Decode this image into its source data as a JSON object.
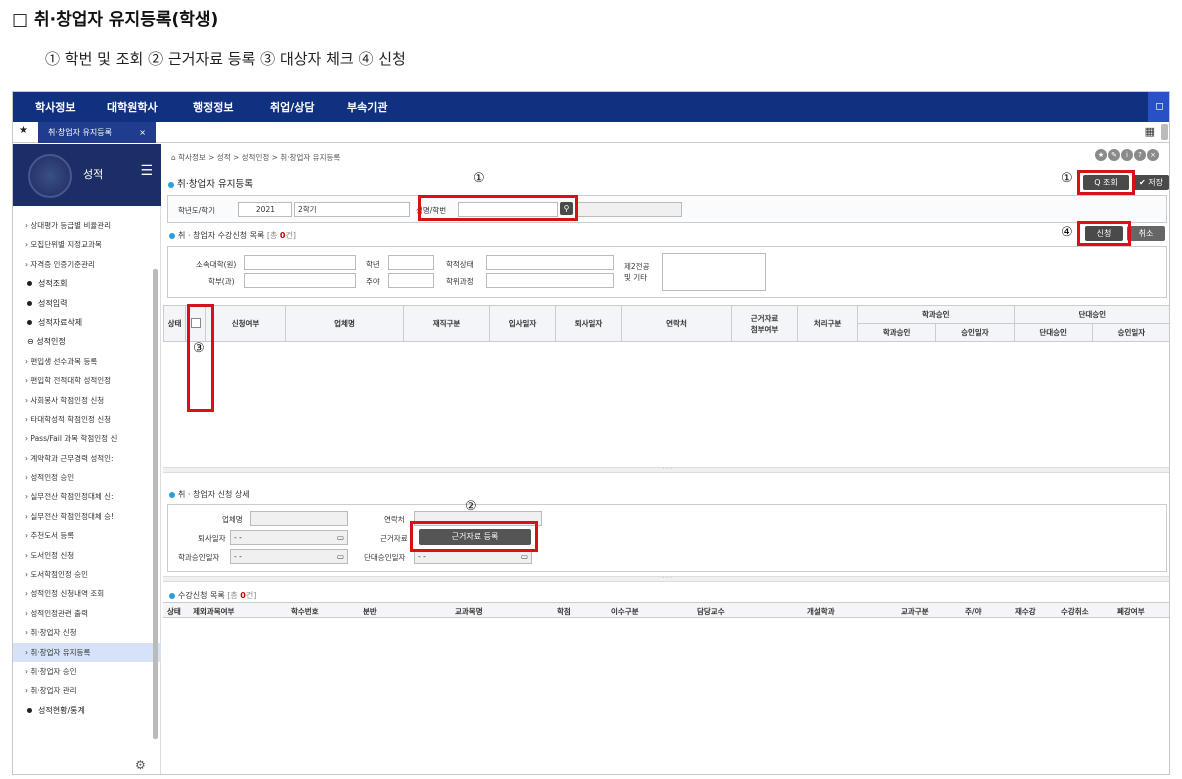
{
  "doc": {
    "title": "□ 취·창업자 유지등록(학생)",
    "steps": "① 학번 및 조회 ② 근거자료 등록 ③ 대상자 체크 ④ 신청"
  },
  "topnav": {
    "items": [
      "학사정보",
      "대학원학사",
      "행정정보",
      "취업/상담",
      "부속기관"
    ],
    "bookmark": "◻"
  },
  "tab": {
    "label": "취·창업자 유지등록",
    "close": "×"
  },
  "sidebar": {
    "title": "성적",
    "items": [
      {
        "label": "상대평가 등급별 비율관리",
        "kind": "sub"
      },
      {
        "label": "모집단위별 지정교과목",
        "kind": "sub"
      },
      {
        "label": "자격증 인증기준관리",
        "kind": "sub"
      },
      {
        "label": "성적조회",
        "kind": "top"
      },
      {
        "label": "성적입력",
        "kind": "top"
      },
      {
        "label": "성적자료삭제",
        "kind": "top"
      },
      {
        "label": "성적인정",
        "kind": "open"
      },
      {
        "label": "편입생 선수과목 등록",
        "kind": "sub"
      },
      {
        "label": "편입학 전적대학 성적인정",
        "kind": "sub"
      },
      {
        "label": "사회봉사 학점인정 신청",
        "kind": "sub"
      },
      {
        "label": "타대학성적 학점인정 신청",
        "kind": "sub"
      },
      {
        "label": "Pass/Fail 과목 학점인정 신",
        "kind": "sub"
      },
      {
        "label": "계약학과 근무경력 성적인:",
        "kind": "sub"
      },
      {
        "label": "성적인정 승인",
        "kind": "sub"
      },
      {
        "label": "실무전산 학점인정대체 신:",
        "kind": "sub"
      },
      {
        "label": "실무전산 학점인정대체 승!",
        "kind": "sub"
      },
      {
        "label": "추천도서 등록",
        "kind": "sub"
      },
      {
        "label": "도서인정 신청",
        "kind": "sub"
      },
      {
        "label": "도서학점인정 승인",
        "kind": "sub"
      },
      {
        "label": "성적인정 신청내역 조회",
        "kind": "sub"
      },
      {
        "label": "성적인정관련 출력",
        "kind": "sub"
      },
      {
        "label": "취·창업자 신청",
        "kind": "sub"
      },
      {
        "label": "취·창업자 유지등록",
        "kind": "active"
      },
      {
        "label": "취·창업자 승인",
        "kind": "sub"
      },
      {
        "label": "취·창업자 관리",
        "kind": "sub"
      },
      {
        "label": "성적현황/통계",
        "kind": "top"
      }
    ]
  },
  "breadcrumb": "⌂ 학사정보 > 성적 > 성적인정 > 취·창업자 유지등록",
  "page_title": "취·창업자 유지등록",
  "buttons": {
    "search": "Q 조회",
    "save": "✔ 저장",
    "apply": "신청",
    "cancel": "취소",
    "evidence": "근거자료 등록"
  },
  "filter": {
    "term_label": "학년도/학기",
    "year": "2021",
    "semester": "2학기",
    "name_label": "성명/학번"
  },
  "apply_list": {
    "title": "취 · 창업자 수강신청 목록",
    "count_prefix": "[총 ",
    "count": "0",
    "count_suffix": "건]",
    "form": {
      "college": "소속대학(원)",
      "dept": "학부(과)",
      "grade": "학년",
      "daynight": "주야",
      "status": "학적상태",
      "course": "학위과정",
      "major2": "제2전공",
      "etc": "및 기타"
    },
    "columns": [
      "상태",
      "신청여부",
      "업체명",
      "재직구분",
      "입사일자",
      "퇴사일자",
      "연락처",
      "근거자료",
      "첨부여부",
      "처리구분",
      "학과승인",
      "학과승인",
      "승인일자",
      "단대승인",
      "단대승인",
      "승인일자"
    ]
  },
  "detail": {
    "title": "취 · 창업자 신청 상세",
    "company": "업체명",
    "contact": "연락처",
    "leave_date": "퇴사일자",
    "evidence": "근거자료",
    "dept_date": "학과승인일자",
    "college_date": "단대승인일자",
    "date_value": "- -"
  },
  "course_list": {
    "title": "수강신청 목록",
    "count_prefix": "[총 ",
    "count": "0",
    "count_suffix": "건]",
    "columns": [
      "상태",
      "제외과목여부",
      "학수번호",
      "분반",
      "교과목명",
      "학점",
      "이수구분",
      "담당교수",
      "개설학과",
      "교과구분",
      "주/야",
      "재수강",
      "수강취소",
      "폐강여부"
    ]
  },
  "callouts": {
    "one": "①",
    "two": "②",
    "three": "③",
    "four": "④"
  },
  "colors": {
    "nav": "#103080",
    "highlight": "#d81018",
    "accent": "#2a9fd6"
  }
}
